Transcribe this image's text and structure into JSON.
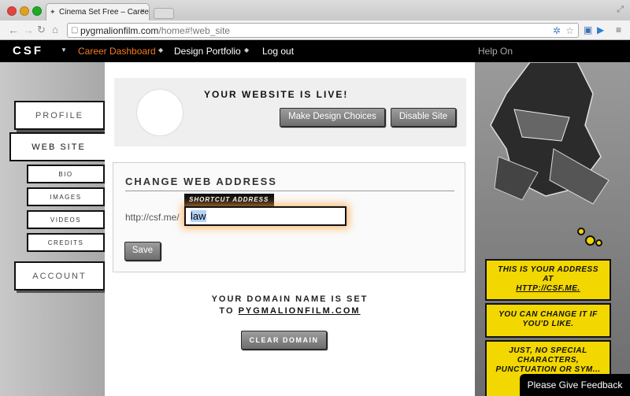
{
  "browser": {
    "tab_title": "Cinema Set Free – Career D",
    "tab_close": "×",
    "url_domain": "pygmalionfilm.com",
    "url_path": "/home#!web_site"
  },
  "site_nav": {
    "logo": "CSF",
    "items": [
      {
        "label": "Career Dashboard",
        "active": true
      },
      {
        "label": "Design Portfolio",
        "active": false
      },
      {
        "label": "Log out",
        "active": false
      }
    ],
    "help": "Help On"
  },
  "sidebar": {
    "profile": "Profile",
    "web_site": "Web Site",
    "sub_items": [
      "Bio",
      "Images",
      "Videos",
      "Credits"
    ],
    "account": "Account"
  },
  "live_panel": {
    "title": "Your Website is Live!",
    "design_button": "Make Design Choices",
    "disable_button": "Disable Site"
  },
  "address_panel": {
    "title": "Change Web Address",
    "shortcut_label": "Shortcut Address",
    "prefix": "http://csf.me/",
    "value": "law",
    "save_button": "Save"
  },
  "domain": {
    "line1": "Your domain name is set",
    "line2_prefix": "to",
    "domain_name": "pygmalionfilm.com",
    "clear_button": "Clear Domain"
  },
  "comic": {
    "bubble1_text": "This is your address at",
    "bubble1_link": "http://csf.me.",
    "bubble2": "You can change it if you'd like.",
    "bubble3": "Just, no special characters, punctuation or sym... web..."
  },
  "feedback": "Please Give Feedback",
  "colors": {
    "accent": "#f47a1f",
    "bubble": "#f2d700"
  }
}
